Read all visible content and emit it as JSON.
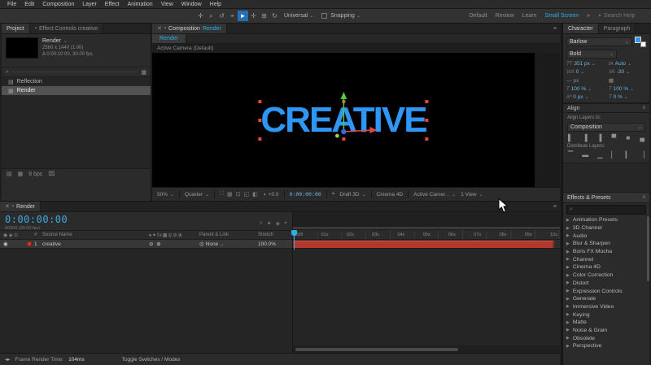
{
  "colors": {
    "accent_cyan": "#2daee9",
    "creative_blue": "#2e96f5",
    "timeline_red": "#b5372c"
  },
  "icons": {
    "close": "✕",
    "menu": "≡",
    "search": "⌕",
    "chev": "⌄",
    "tri_down": "▼",
    "tri_right": "▶",
    "panel_dot": "▪",
    "folder": "▤",
    "comp": "▦",
    "eye": "◉",
    "pickwhip": "◎",
    "camera": "⌖",
    "grid": "▦",
    "trash": "⌧",
    "collapse": "▸",
    "exposure": "◑",
    "more": "»"
  },
  "menubar": {
    "items": [
      "File",
      "Edit",
      "Composition",
      "Layer",
      "Effect",
      "Animation",
      "View",
      "Window",
      "Help"
    ]
  },
  "toolbar": {
    "tools_left": [
      {
        "name": "pan-tool",
        "glyph": "✛"
      },
      {
        "name": "zoom-tool",
        "glyph": "⌕"
      },
      {
        "name": "orbit-tool",
        "glyph": "↺"
      },
      {
        "name": "camera-tool",
        "glyph": "⌖"
      }
    ],
    "selection_glyph": "►",
    "tools_right": [
      {
        "name": "hand-tool",
        "glyph": "✛"
      },
      {
        "name": "pan-behind-tool",
        "glyph": "⊞"
      },
      {
        "name": "rotate-tool",
        "glyph": "↻"
      }
    ],
    "universal": "Universal",
    "snapping": "Snapping",
    "ws_default": "Default",
    "ws_review": "Review",
    "ws_learn": "Learn",
    "ws_small": "Small Screen",
    "search_placeholder": "Search Help"
  },
  "project_panel": {
    "tab_project": "Project",
    "tab_effects": "Effect Controls creative",
    "item_name": "Render",
    "item_detail_1": "2560 x 1440 (1.00)",
    "item_detail_2": "Δ 0:00:10:00, 30.00 fps",
    "rows": [
      {
        "name": "Reflection"
      },
      {
        "name": "Render"
      }
    ],
    "bit_depth": "8 bpc"
  },
  "comp_panel": {
    "tab_prefix": "Composition",
    "tab_comp": "Render",
    "viewer_tab": "Render",
    "camera_label": "Active Camera (Default)",
    "canvas_text": "CREATIVE",
    "zoom": "50%",
    "resolution": "Quarter",
    "exposure": "+0.0",
    "timecode": "0:00:00:00",
    "fast_preview": "Draft 3D",
    "renderer": "Cinema 4D",
    "view_menu": "Active Camer...",
    "views": "1 View"
  },
  "timeline": {
    "tab": "Render",
    "timecode": "0:00:00:00",
    "frame_info": "00000 (30.00 fps)",
    "head_icons": "◉ ◈ ⊙",
    "col_hash": "#",
    "col_source": "Source Name",
    "col_switches": "♦✦fx▦◎⊘⊕",
    "col_parent": "Parent & Link",
    "col_stretch": "Stretch",
    "layer_eye": "◉",
    "layer_index": "1",
    "layer_name": "creative",
    "layer_switches": "⊘ ⊕",
    "layer_parent": "None",
    "layer_stretch": "100.0%",
    "ruler": [
      ":00f",
      "01s",
      "02s",
      "03s",
      "04s",
      "05s",
      "06s",
      "07s",
      "08s",
      "09s",
      "10s"
    ]
  },
  "status_bar": {
    "render_label": "Frame Render Time:",
    "render_value": "104ms",
    "toggle": "Toggle Switches / Modes"
  },
  "character": {
    "tab_character": "Character",
    "tab_paragraph": "Paragraph",
    "font_family": "Barlow",
    "font_style": "Bold",
    "size_icon": "TT",
    "size": "351 px",
    "leading_icon": "tA",
    "leading": "Auto",
    "kerning_icon": "V/A",
    "kerning": "0",
    "tracking_icon": "VA",
    "tracking": "-30",
    "stroke_dash": "—",
    "stroke_unit": "px",
    "vscale_icon": "T",
    "vscale": "100 %",
    "hscale_icon": "T",
    "hscale": "100 %",
    "baseline_icon": "Aª",
    "baseline": "0 px",
    "tsume_icon": "T",
    "tsume": "0 %"
  },
  "align": {
    "title": "Align",
    "to_label": "Align Layers to:",
    "to_value": "Composition",
    "distribute": "Distribute Layers:"
  },
  "effects": {
    "title": "Effects & Presets",
    "categories": [
      "Animation Presets",
      "3D Channel",
      "Audio",
      "Blur & Sharpen",
      "Boris FX Mocha",
      "Channel",
      "Cinema 4D",
      "Color Correction",
      "Distort",
      "Expression Controls",
      "Generate",
      "Immersive Video",
      "Keying",
      "Matte",
      "Noise & Grain",
      "Obsolete",
      "Perspective"
    ]
  }
}
